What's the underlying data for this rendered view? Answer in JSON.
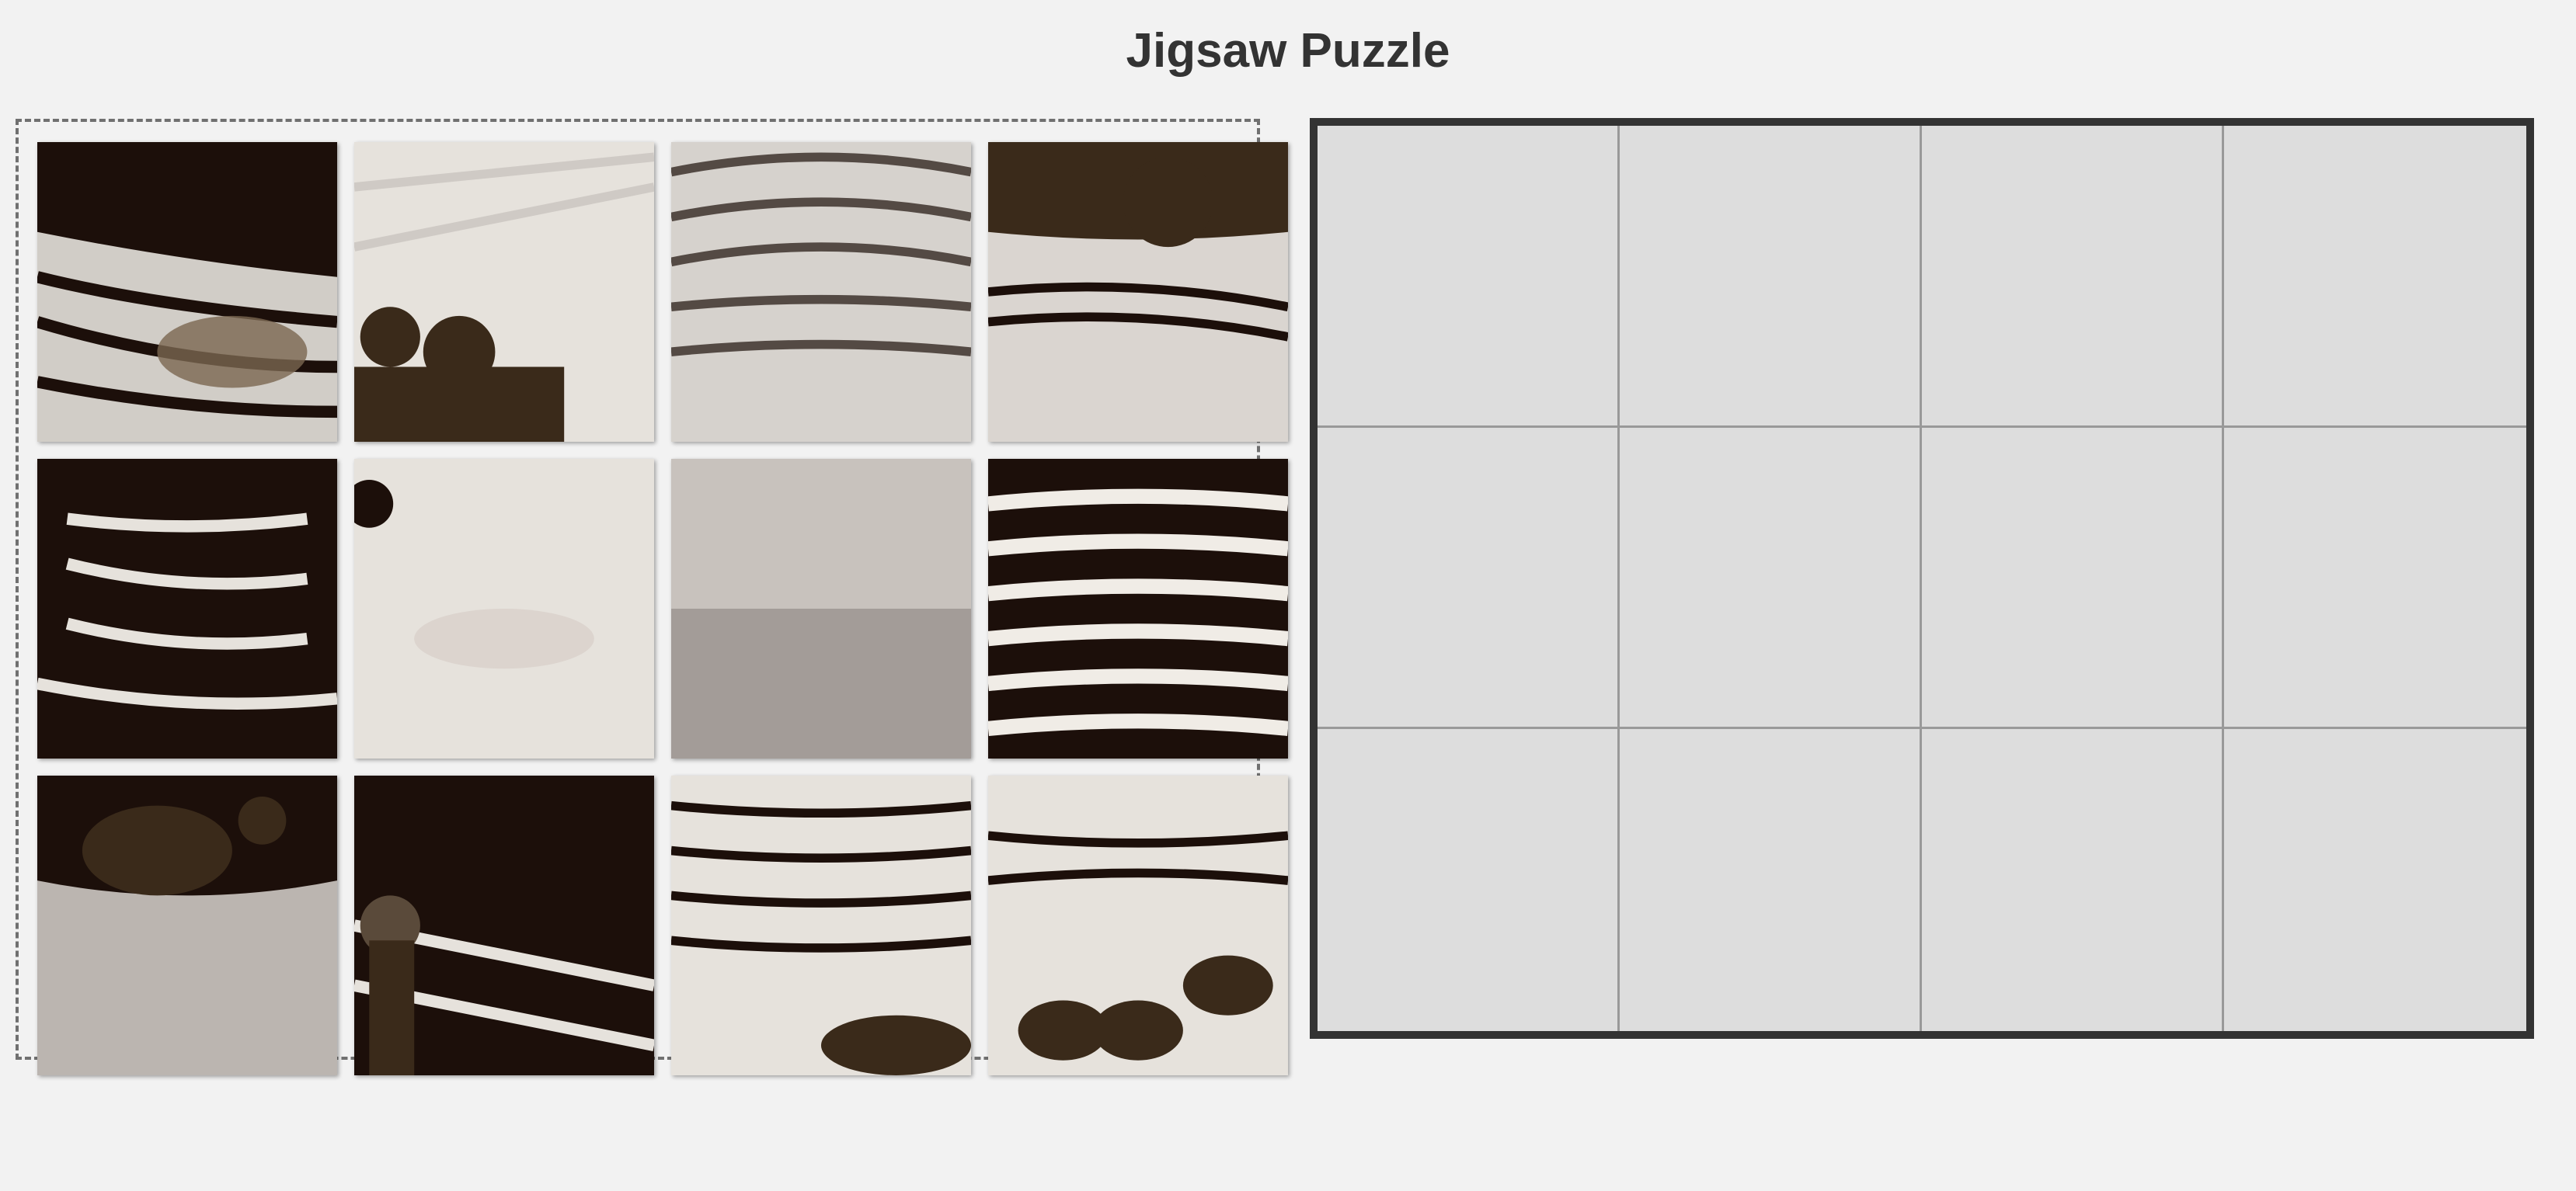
{
  "title": "Jigsaw Puzzle",
  "board": {
    "rows": 3,
    "cols": 4
  },
  "tray": {
    "pieces": [
      {
        "name": "piece-1",
        "theme": "dark-water-duck",
        "tone": "dark"
      },
      {
        "name": "piece-2",
        "theme": "light-water-ducklings",
        "tone": "light"
      },
      {
        "name": "piece-3",
        "theme": "rippled-water",
        "tone": "light"
      },
      {
        "name": "piece-4",
        "theme": "water-ducklings-top",
        "tone": "light"
      },
      {
        "name": "piece-5",
        "theme": "dark-rippled-water",
        "tone": "dark"
      },
      {
        "name": "piece-6",
        "theme": "calm-light-water",
        "tone": "light"
      },
      {
        "name": "piece-7",
        "theme": "calm-grey-water",
        "tone": "grey"
      },
      {
        "name": "piece-8",
        "theme": "dark-rippled-water",
        "tone": "dark"
      },
      {
        "name": "piece-9",
        "theme": "ducklings-calm-water",
        "tone": "light"
      },
      {
        "name": "piece-10",
        "theme": "dark-water-duck-head",
        "tone": "dark"
      },
      {
        "name": "piece-11",
        "theme": "rippled-water-ducklings",
        "tone": "light"
      },
      {
        "name": "piece-12",
        "theme": "rippled-water-ducklings",
        "tone": "light"
      }
    ]
  },
  "colors": {
    "background": "#f2f2f2",
    "board_border": "#333333",
    "cell": "#dddddd",
    "cell_border": "#999999",
    "tray_border": "#707070",
    "water_dark": "#1c0f0a",
    "water_light": "#e6e2dc",
    "water_grey": "#b3aca8",
    "duck_brown": "#3a2a1a"
  }
}
